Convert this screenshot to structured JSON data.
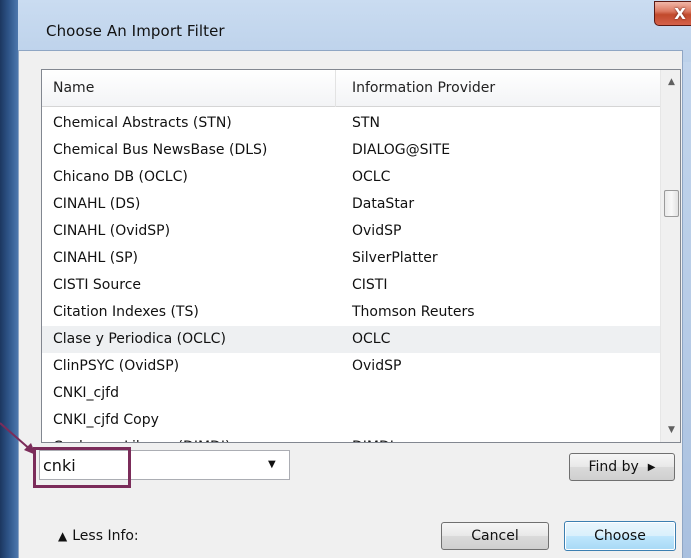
{
  "window": {
    "title": "Choose An Import Filter",
    "close_glyph": "X"
  },
  "list": {
    "columns": [
      "Name",
      "Information Provider"
    ],
    "rows": [
      {
        "name": "Chemical Abstracts (STN)",
        "provider": "STN"
      },
      {
        "name": "Chemical Bus NewsBase (DLS)",
        "provider": "DIALOG@SITE"
      },
      {
        "name": "Chicano DB (OCLC)",
        "provider": "OCLC"
      },
      {
        "name": "CINAHL (DS)",
        "provider": "DataStar"
      },
      {
        "name": "CINAHL (OvidSP)",
        "provider": "OvidSP"
      },
      {
        "name": "CINAHL (SP)",
        "provider": "SilverPlatter"
      },
      {
        "name": "CISTI Source",
        "provider": "CISTI"
      },
      {
        "name": "Citation Indexes (TS)",
        "provider": "Thomson Reuters"
      },
      {
        "name": "Clase y Periodica (OCLC)",
        "provider": "OCLC"
      },
      {
        "name": "ClinPSYC (OvidSP)",
        "provider": "OvidSP"
      },
      {
        "name": "CNKI_cjfd",
        "provider": ""
      },
      {
        "name": "CNKI_cjfd Copy",
        "provider": ""
      },
      {
        "name": "Cochrane Library (DIMDI)",
        "provider": "DIMDI"
      }
    ],
    "selected_index": 8
  },
  "search": {
    "value": "cnki"
  },
  "buttons": {
    "find_by": "Find by",
    "cancel": "Cancel",
    "choose": "Choose",
    "less_info": "Less Info:"
  },
  "icons": {
    "close": "close-icon",
    "dropdown": "chevron-down-icon",
    "find_by_arrow": "triangle-right-icon",
    "less_info": "arrow-up-icon",
    "scroll_up": "scroll-up-icon",
    "scroll_down": "scroll-down-icon"
  },
  "colors": {
    "highlight": "#7b2c5a",
    "selected_row": "#eef0f2",
    "titlebar": "#bcd1ea",
    "close_button": "#c14a2c"
  }
}
